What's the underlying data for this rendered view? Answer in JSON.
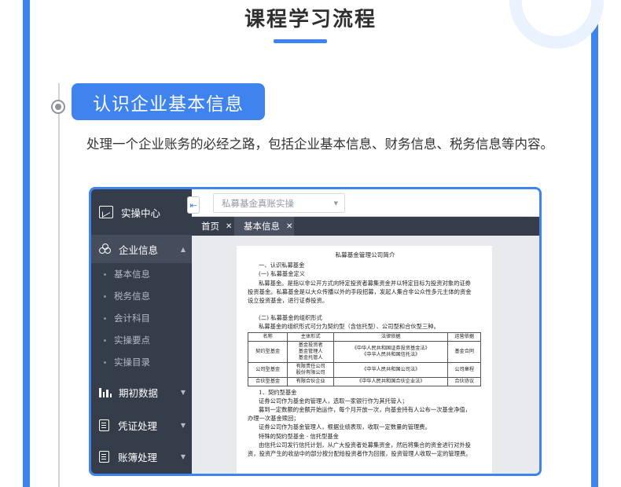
{
  "header": {
    "title": "课程学习流程"
  },
  "section": {
    "title": "认识企业基本信息",
    "description": "处理一个企业账务的必经之路，包括企业基本信息、财务信息、税务信息等内容。"
  },
  "app": {
    "sidebar": {
      "head": "实操中心",
      "active_item": "企业信息",
      "sub_items": [
        "基本信息",
        "税务信息",
        "会计科目",
        "实操要点",
        "实操目录"
      ],
      "sections": [
        "期初数据",
        "凭证处理",
        "账簿处理"
      ]
    },
    "topbar": {
      "select_value": "私募基金真账实操"
    },
    "tabs": [
      {
        "label": "首页"
      },
      {
        "label": "基本信息"
      }
    ],
    "document": {
      "title": "私募基金管理公司简介",
      "lines_before_table": [
        "一、认识私募基金",
        "(一) 私募基金定义",
        "私募基金。是指以非公开方式向特定投资者募集资金并以特定目标为投资对象的证券",
        "投资基金。私募基金是以大众传播以外的手段招募，发起人集合非公众性多元主体的资金",
        "设立投资基金，进行证券投资。",
        "(二) 私募基金的组织形式",
        "私募基金的组织形式可分为契约型（含信托型）、公司型和合伙型三种。"
      ],
      "table": {
        "headers": [
          "名称",
          "主体形式",
          "法律依据",
          "运营依据"
        ],
        "rows": [
          [
            "契约型基金",
            "基金投资者\n基金管理人\n基金托管人",
            "《中华人民共和国证券投资基金法》\n《中华人民共和国信托法》",
            "基金合同"
          ],
          [
            "公司型基金",
            "有限责任公司\n股份有限公司",
            "《中华人民共和国公司法》",
            "公司章程"
          ],
          [
            "合伙型基金",
            "有限合伙企业",
            "《中华人民共和国合伙企业法》",
            "合伙协议"
          ]
        ]
      },
      "lines_after_table": [
        "1、契约型基金",
        "证券公司作为基金的管理人，选取一家银行作为其托管人；",
        "募到一定数额的金额开始运作，每个月开放一次，向基金持有人公布一次基金净值，",
        "办理一次基金赎回；",
        "证券公司作为基金管理人，根据业绩表现，收取一定数量的管理费。",
        "特殊的契约型基金 - 信托型基金",
        "由信托公司发行信托计划，从广大投资者处募集资金，然后将集合的资金进行对外投",
        "资，投资产生的收益中的部分按分配给投资者作为回报，投资管理人收取一定的管理费。"
      ]
    }
  },
  "colors": {
    "accent": "#3e83ee",
    "sidebar_bg": "#353c4a",
    "text": "#333333"
  }
}
